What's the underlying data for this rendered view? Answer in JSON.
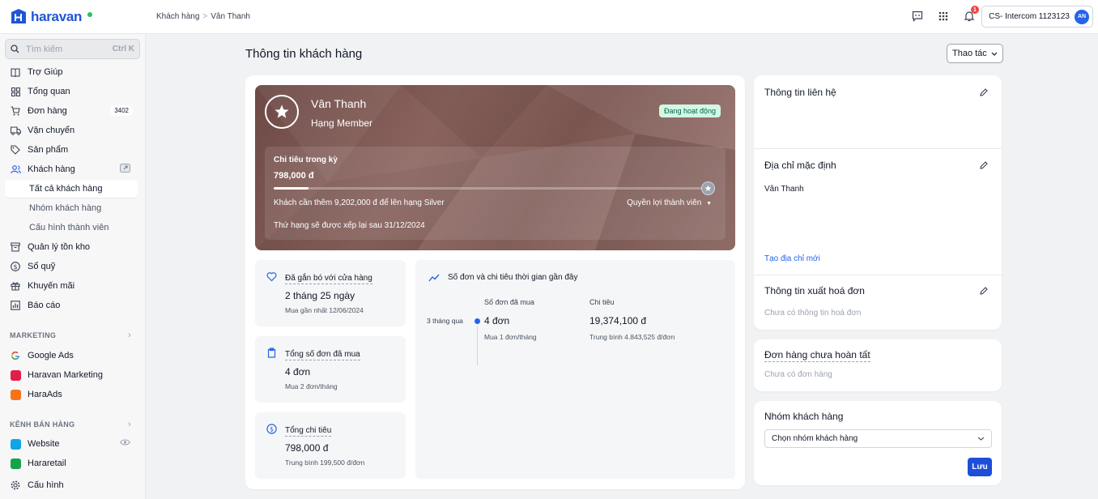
{
  "app": {
    "brand": "haravan",
    "brand_color": "#1e56d6"
  },
  "breadcrumb": [
    "Khách hàng",
    "Vân Thanh"
  ],
  "header": {
    "notifications": "1",
    "store_name": "CS- Intercom 1123123",
    "avatar_initials": "AN"
  },
  "sidebar": {
    "search_placeholder": "Tìm kiếm",
    "search_shortcut": "Ctrl K",
    "items": [
      {
        "label": "Trợ Giúp",
        "icon": "book-icon"
      },
      {
        "label": "Tổng quan",
        "icon": "dashboard-icon"
      },
      {
        "label": "Đơn hàng",
        "icon": "cart-icon",
        "badge": "3402"
      },
      {
        "label": "Vận chuyển",
        "icon": "truck-icon"
      },
      {
        "label": "Sản phẩm",
        "icon": "tag-icon"
      },
      {
        "label": "Khách hàng",
        "icon": "users-icon"
      },
      {
        "label": "Tất cả khách hàng",
        "sub": true
      },
      {
        "label": "Nhóm khách hàng",
        "sub": true
      },
      {
        "label": "Cấu hình thành viên",
        "sub": true
      },
      {
        "label": "Quản lý tồn kho",
        "icon": "box-icon"
      },
      {
        "label": "Sổ quỹ",
        "icon": "money-icon"
      },
      {
        "label": "Khuyến mãi",
        "icon": "gift-icon"
      },
      {
        "label": "Báo cáo",
        "icon": "report-icon"
      }
    ],
    "marketing_title": "MARKETING",
    "marketing": [
      {
        "label": "Google Ads",
        "icon": "google-icon"
      },
      {
        "label": "Haravan Marketing",
        "icon": "haravan-marketing-icon"
      },
      {
        "label": "HaraAds",
        "icon": "haraads-icon"
      }
    ],
    "channels_title": "KÊNH BÁN HÀNG",
    "channels": [
      {
        "label": "Website",
        "icon": "website-icon"
      },
      {
        "label": "Hararetail",
        "icon": "hararetail-icon"
      }
    ],
    "settings_label": "Cấu hình"
  },
  "page": {
    "title": "Thông tin khách hàng",
    "action_label": "Thao tác"
  },
  "customer": {
    "name": "Vân Thanh",
    "rank": "Hạng Member",
    "status": "Đang hoạt động",
    "spend_label": "Chi tiêu trong kỳ",
    "spend_amount": "798,000 đ",
    "progress": 0.08,
    "need_text": "Khách cần thêm 9,202,000 đ để lên hạng Silver",
    "benefit_label": "Quyền lợi thành viên",
    "reset_text": "Thứ hạng sẽ được xếp lại sau 31/12/2024"
  },
  "stats": [
    {
      "title": "Đã gắn bó với cửa hàng",
      "value": "2 tháng 25 ngày",
      "sub": "Mua gần nhất 12/06/2024",
      "icon": "heart-icon"
    },
    {
      "title": "Tổng số đơn đã mua",
      "value": "4 đơn",
      "sub": "Mua 2 đơn/tháng",
      "icon": "clipboard-icon"
    },
    {
      "title": "Tổng chi tiêu",
      "value": "798,000 đ",
      "sub": "Trung bình 199,500 đ/đơn",
      "icon": "dollar-icon"
    }
  ],
  "trend": {
    "title": "Số đơn và chi tiêu thời gian gần đây",
    "period": "3 tháng qua",
    "orders_header": "Số đơn đã mua",
    "orders_value": "4 đơn",
    "orders_sub": "Mua 1 đơn/tháng",
    "spend_header": "Chi tiêu",
    "spend_value": "19,374,100 đ",
    "spend_sub": "Trung bình 4.843,525 đ/đơn"
  },
  "right": {
    "contact_title": "Thông tin liên hệ",
    "address_title": "Địa chỉ mặc định",
    "address_name": "Vân Thanh",
    "new_address_link": "Tạo địa chỉ mới",
    "invoice_title": "Thông tin xuất hoá đơn",
    "invoice_empty": "Chưa có thông tin hoá đơn",
    "pending_title": "Đơn hàng chưa hoàn tất",
    "pending_empty": "Chưa có đơn hàng",
    "group_title": "Nhóm khách hàng",
    "group_select": "Chọn nhóm khách hàng",
    "save_label": "Lưu"
  }
}
